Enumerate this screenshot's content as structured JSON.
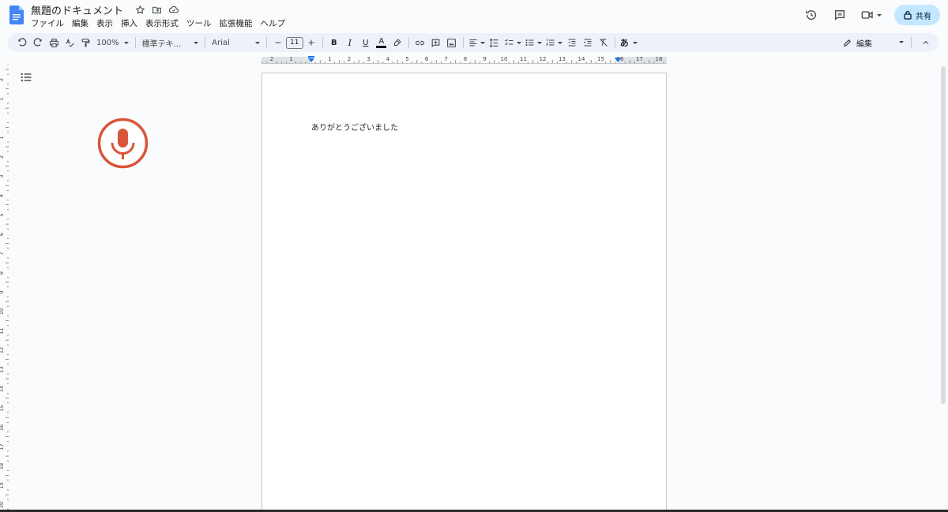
{
  "header": {
    "title": "無題のドキュメント",
    "menu": [
      "ファイル",
      "編集",
      "表示",
      "挿入",
      "表示形式",
      "ツール",
      "拡張機能",
      "ヘルプ"
    ],
    "share_label": "共有"
  },
  "toolbar": {
    "zoom": "100%",
    "style": "標準テキ...",
    "font": "Arial",
    "font_size": "11",
    "bold": "B",
    "italic": "I",
    "underline": "U",
    "text_color": "A",
    "input_tools": "あ",
    "mode": "編集"
  },
  "ruler": {
    "h_labels": [
      "2",
      "1",
      "1",
      "2",
      "3",
      "4",
      "5",
      "6",
      "7",
      "8",
      "9",
      "10",
      "11",
      "12",
      "13",
      "14",
      "15",
      "16",
      "17",
      "18"
    ],
    "v_labels": [
      "2",
      "1",
      "1",
      "2",
      "3",
      "4",
      "5",
      "6",
      "7",
      "8",
      "9",
      "10",
      "11",
      "12",
      "13",
      "14",
      "15",
      "16",
      "17",
      "18",
      "19",
      "20"
    ]
  },
  "document": {
    "body_text": "ありがとうございました"
  },
  "colors": {
    "accent": "#1a73e8",
    "share_bg": "#c2e7ff",
    "mic": "#d9553a",
    "toolbar_bg": "#edf2fa"
  }
}
